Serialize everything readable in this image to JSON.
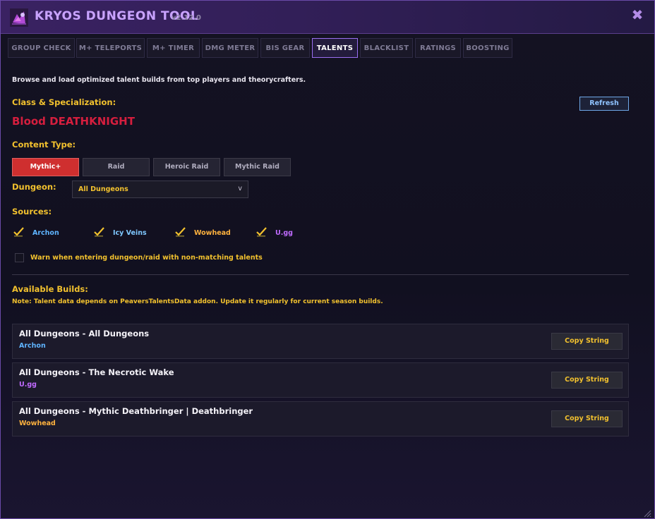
{
  "app": {
    "title": "KRYOS DUNGEON TOOL",
    "version": "v2.12.0",
    "close_glyph": "✖"
  },
  "tabs": [
    {
      "label": "GROUP CHECK"
    },
    {
      "label": "M+ TELEPORTS"
    },
    {
      "label": "M+ TIMER"
    },
    {
      "label": "DMG METER"
    },
    {
      "label": "BIS GEAR"
    },
    {
      "label": "TALENTS",
      "active": true
    },
    {
      "label": "BLACKLIST"
    },
    {
      "label": "RATINGS"
    },
    {
      "label": "BOOSTING"
    }
  ],
  "main": {
    "intro": "Browse and load optimized talent builds from top players and theorycrafters.",
    "class_spec_label": "Class & Specialization:",
    "class_name": "Blood DEATHKNIGHT",
    "class_color": "#d51e3e",
    "refresh_label": "Refresh",
    "content_type_label": "Content Type:",
    "content_types": [
      {
        "label": "Mythic+",
        "active": true
      },
      {
        "label": "Raid"
      },
      {
        "label": "Heroic Raid"
      },
      {
        "label": "Mythic Raid"
      }
    ],
    "dungeon_label": "Dungeon:",
    "dungeon_selected": "All Dungeons",
    "dungeon_chevron": "v",
    "sources_label": "Sources:",
    "sources": [
      {
        "label": "Archon",
        "checked": true,
        "color": "#5fb4ff"
      },
      {
        "label": "Icy Veins",
        "checked": true,
        "color": "#7fc7ff"
      },
      {
        "label": "Wowhead",
        "checked": true,
        "color": "#ffb23e"
      },
      {
        "label": "U.gg",
        "checked": true,
        "color": "#c06bff"
      }
    ],
    "warn_label": "Warn when entering dungeon/raid with non-matching talents",
    "warn_checked": false,
    "available_builds_label": "Available Builds:",
    "note": "Note: Talent data depends on PeaversTalentsData addon. Update it regularly for current season builds.",
    "builds": [
      {
        "title": "All Dungeons - All Dungeons",
        "source": "Archon",
        "source_color": "#5fb4ff",
        "button": "Copy String"
      },
      {
        "title": "All Dungeons - The Necrotic Wake",
        "source": "U.gg",
        "source_color": "#c06bff",
        "button": "Copy String"
      },
      {
        "title": "All Dungeons - Mythic Deathbringer | Deathbringer",
        "source": "Wowhead",
        "source_color": "#ffb23e",
        "button": "Copy String"
      }
    ]
  },
  "icons": {
    "logo": "dungeon-logo-icon",
    "check": "check-icon",
    "resize": "resize-grip-icon"
  }
}
